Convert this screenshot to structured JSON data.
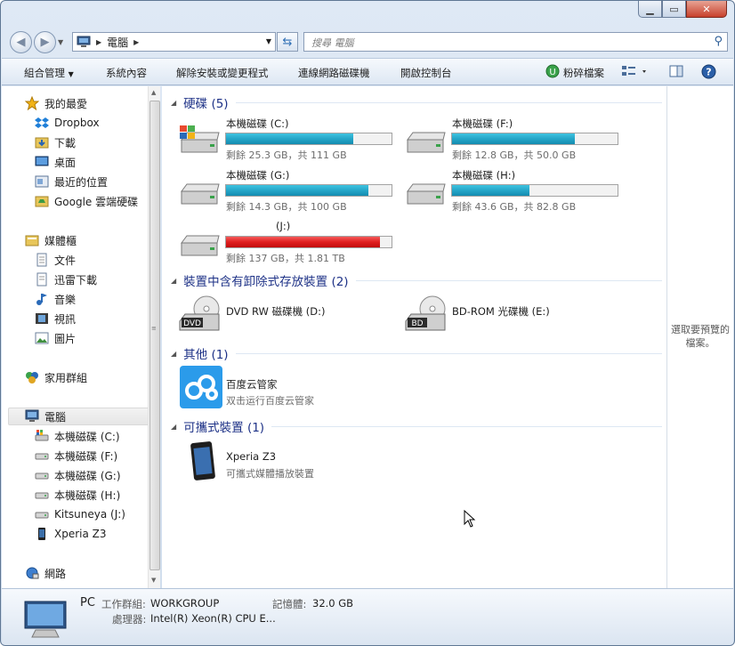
{
  "address": {
    "path": [
      "電腦"
    ],
    "search_placeholder": "搜尋 電腦"
  },
  "toolbar": {
    "organize": "組合管理",
    "system_properties": "系統內容",
    "uninstall": "解除安裝或變更程式",
    "map_drive": "連線網路磁碟機",
    "control_panel": "開啟控制台",
    "shred": "粉碎檔案"
  },
  "nav": {
    "favorites": "我的最愛",
    "fav_items": [
      "Dropbox",
      "下載",
      "桌面",
      "最近的位置",
      "Google 雲端硬碟"
    ],
    "libraries": "媒體櫃",
    "lib_items": [
      "文件",
      "迅雷下載",
      "音樂",
      "視訊",
      "圖片"
    ],
    "homegroup": "家用群組",
    "computer": "電腦",
    "computer_items": [
      "本機磁碟 (C:)",
      "本機磁碟 (F:)",
      "本機磁碟 (G:)",
      "本機磁碟 (H:)",
      "Kitsuneya (J:)",
      "Xperia Z3"
    ],
    "network": "網路"
  },
  "groups": {
    "hdd": "硬碟 (5)",
    "removable": "裝置中含有卸除式存放裝置 (2)",
    "other": "其他 (1)",
    "portable": "可攜式裝置 (1)"
  },
  "drives": [
    {
      "name": "本機磁碟 (C:)",
      "free": "剩餘 25.3 GB，共 111 GB",
      "used_fraction": 0.77,
      "color": "#25a6c8"
    },
    {
      "name": "本機磁碟 (F:)",
      "free": "剩餘 12.8 GB，共 50.0 GB",
      "used_fraction": 0.74,
      "color": "#25a6c8"
    },
    {
      "name": "本機磁碟 (G:)",
      "free": "剩餘 14.3 GB，共 100 GB",
      "used_fraction": 0.86,
      "color": "#25a6c8"
    },
    {
      "name": "本機磁碟 (H:)",
      "free": "剩餘 43.6 GB，共 82.8 GB",
      "used_fraction": 0.47,
      "color": "#25a6c8"
    },
    {
      "name": "(J:)",
      "free": "剩餘 137 GB，共 1.81 TB",
      "used_fraction": 0.93,
      "color": "#e01f1f"
    }
  ],
  "removable": [
    {
      "name": "DVD RW 磁碟機 (D:)",
      "badge": "DVD"
    },
    {
      "name": "BD-ROM 光碟機 (E:)",
      "badge": "BD"
    }
  ],
  "other": {
    "name": "百度云管家",
    "sub": "双击运行百度云管家"
  },
  "portable": {
    "name": "Xperia Z3",
    "sub": "可攜式媒體播放裝置"
  },
  "preview": {
    "message": "選取要預覽的檔案。"
  },
  "details": {
    "name": "PC",
    "workgroup_label": "工作群組:",
    "workgroup": "WORKGROUP",
    "memory_label": "記憶體:",
    "memory": "32.0 GB",
    "cpu_label": "處理器:",
    "cpu": "Intel(R) Xeon(R) CPU E..."
  }
}
